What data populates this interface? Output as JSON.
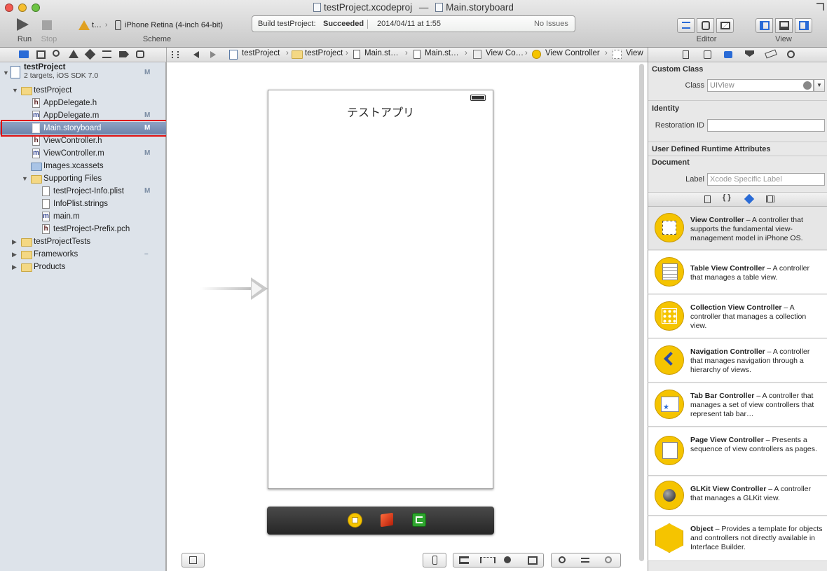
{
  "window": {
    "title": "testProject.xcodeproj",
    "title_sep": "—",
    "title_file": "Main.storyboard"
  },
  "toolbar": {
    "run_label": "Run",
    "stop_label": "Stop",
    "scheme_target": "t…",
    "scheme_device": "iPhone Retina (4-inch 64-bit)",
    "scheme_label": "Scheme",
    "status_prefix": "Build testProject:",
    "status_result": "Succeeded",
    "status_time": "2014/04/11 at 1:55",
    "status_issues": "No Issues",
    "editor_label": "Editor",
    "view_label": "View"
  },
  "navigator": {
    "items": [
      {
        "label": "testProject",
        "sub": "2 targets, iOS SDK 7.0",
        "badge": "M",
        "kind": "project"
      },
      {
        "label": "testProject",
        "badge": "",
        "kind": "folder"
      },
      {
        "label": "AppDelegate.h",
        "badge": "",
        "kind": "h"
      },
      {
        "label": "AppDelegate.m",
        "badge": "M",
        "kind": "m"
      },
      {
        "label": "Main.storyboard",
        "badge": "M",
        "kind": "sb"
      },
      {
        "label": "ViewController.h",
        "badge": "",
        "kind": "h"
      },
      {
        "label": "ViewController.m",
        "badge": "M",
        "kind": "m"
      },
      {
        "label": "Images.xcassets",
        "badge": "",
        "kind": "asset"
      },
      {
        "label": "Supporting Files",
        "badge": "",
        "kind": "folder"
      },
      {
        "label": "testProject-Info.plist",
        "badge": "M",
        "kind": "plist"
      },
      {
        "label": "InfoPlist.strings",
        "badge": "",
        "kind": "plist"
      },
      {
        "label": "main.m",
        "badge": "",
        "kind": "m"
      },
      {
        "label": "testProject-Prefix.pch",
        "badge": "",
        "kind": "h"
      },
      {
        "label": "testProjectTests",
        "badge": "",
        "kind": "folder"
      },
      {
        "label": "Frameworks",
        "badge": "–",
        "kind": "folder"
      },
      {
        "label": "Products",
        "badge": "",
        "kind": "folder"
      }
    ]
  },
  "jumpbar": [
    "testProject",
    "testProject",
    "Main.st…",
    "Main.st…",
    "View Co…",
    "View Controller",
    "View"
  ],
  "canvas": {
    "scene_title": "テストアプリ"
  },
  "inspector": {
    "custom_class_header": "Custom Class",
    "class_label": "Class",
    "class_value": "UIView",
    "identity_header": "Identity",
    "restoration_label": "Restoration ID",
    "restoration_value": "",
    "runtime_header": "User Defined Runtime Attributes",
    "document_header": "Document",
    "doc_label_label": "Label",
    "doc_label_placeholder": "Xcode Specific Label"
  },
  "library": [
    {
      "name": "View Controller",
      "desc": " – A controller that supports the fundamental view-management model in iPhone OS."
    },
    {
      "name": "Table View Controller",
      "desc": " – A controller that manages a table view."
    },
    {
      "name": "Collection View Controller",
      "desc": " – A controller that manages a collection view."
    },
    {
      "name": "Navigation Controller",
      "desc": " – A controller that manages navigation through a hierarchy of views."
    },
    {
      "name": "Tab Bar Controller",
      "desc": " – A controller that manages a set of view controllers that represent tab bar…"
    },
    {
      "name": "Page View Controller",
      "desc": " – Presents a sequence of view controllers as pages."
    },
    {
      "name": "GLKit View Controller",
      "desc": " – A controller that manages a GLKit view."
    },
    {
      "name": "Object",
      "desc": " – Provides a template for objects and controllers not directly available in Interface Builder."
    }
  ],
  "colors": {
    "selection": "#6d83aa",
    "highlight_box": "#e01010",
    "library_icon": "#f5c400"
  }
}
